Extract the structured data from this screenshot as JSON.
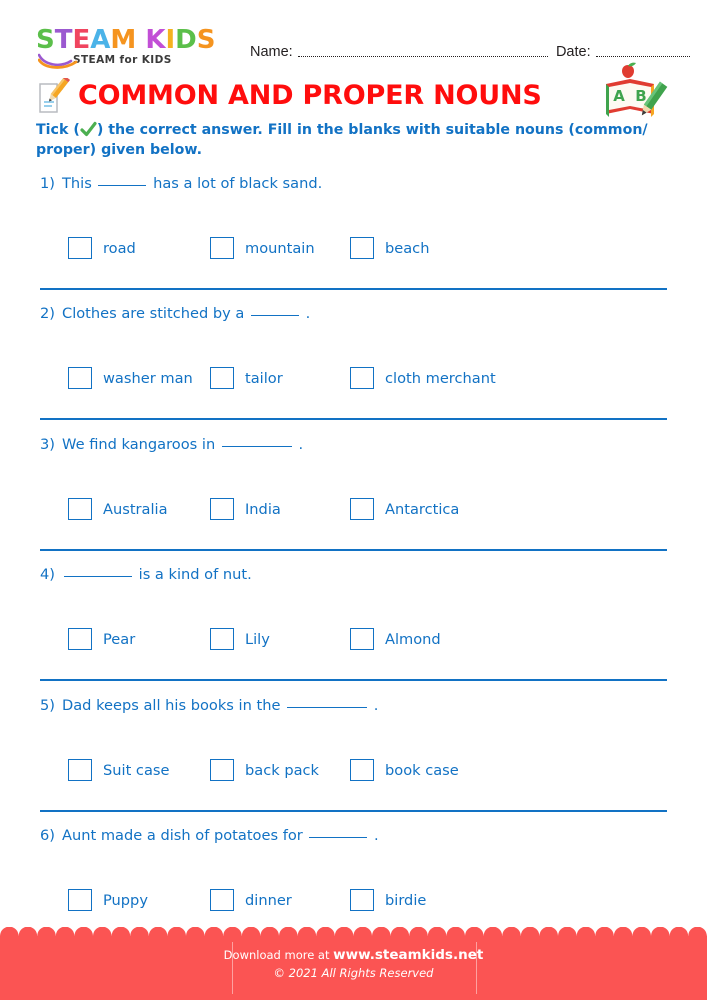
{
  "brand": {
    "logo_letters": [
      {
        "ch": "S",
        "color": "#5bbf4a"
      },
      {
        "ch": "T",
        "color": "#9b59d0"
      },
      {
        "ch": "E",
        "color": "#f0455f"
      },
      {
        "ch": "A",
        "color": "#4bb3e8"
      },
      {
        "ch": "M",
        "color": "#f5941f"
      },
      {
        "ch": " ",
        "color": "#ffffff"
      },
      {
        "ch": "K",
        "color": "#c24fd6"
      },
      {
        "ch": "I",
        "color": "#f5b21f"
      },
      {
        "ch": "D",
        "color": "#5bbf4a"
      },
      {
        "ch": "S",
        "color": "#f5941f"
      }
    ],
    "tagline": "STEAM for KIDS",
    "swoosh_icon": "swoosh-icon"
  },
  "header": {
    "name_label": "Name:",
    "date_label": "Date:"
  },
  "title": {
    "text": "COMMON AND PROPER NOUNS",
    "color": "#ff0d0d",
    "pencil_icon": "pencil-paper-icon",
    "book_icon": "abc-book-icon",
    "book_letter_a": "A",
    "book_letter_b": "B"
  },
  "instruction": {
    "part1": "Tick (",
    "tick_icon": "green-check-icon",
    "part2": ") the correct answer. Fill in the blanks with suitable nouns (common/ proper) given below."
  },
  "theme": {
    "blue": "#1272c4",
    "red": "#ff0d0d",
    "footer_red": "#fb5453",
    "ink": "#231f20"
  },
  "questions": [
    {
      "number": "1)",
      "before": "This",
      "blank_width": 48,
      "after": "has a lot of black sand.",
      "options": [
        "road",
        "mountain",
        "beach"
      ]
    },
    {
      "number": "2)",
      "before": "Clothes are stitched by a",
      "blank_width": 48,
      "after": ".",
      "options": [
        "washer man",
        "tailor",
        "cloth merchant"
      ]
    },
    {
      "number": "3)",
      "before": "We find kangaroos in",
      "blank_width": 70,
      "after": ".",
      "options": [
        "Australia",
        "India",
        "Antarctica"
      ]
    },
    {
      "number": "4)",
      "before": "",
      "blank_width": 68,
      "after": "is a kind of nut.",
      "options": [
        "Pear",
        "Lily",
        "Almond"
      ]
    },
    {
      "number": "5)",
      "before": "Dad keeps all his books in the",
      "blank_width": 80,
      "after": ".",
      "options": [
        "Suit case",
        "back pack",
        "book case"
      ]
    },
    {
      "number": "6)",
      "before": "Aunt made a dish of potatoes for",
      "blank_width": 58,
      "after": ".",
      "options": [
        "Puppy",
        "dinner",
        "birdie"
      ]
    }
  ],
  "footer": {
    "download_text": "Download more at",
    "url": "www.steamkids.net",
    "copyright": "© 2021 All Rights Reserved"
  }
}
